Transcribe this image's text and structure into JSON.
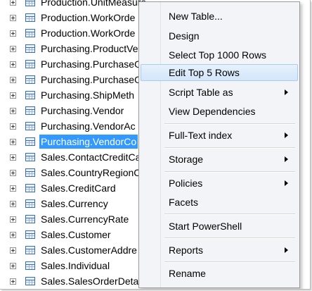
{
  "tree": {
    "items": [
      {
        "label": "Production.UnitMeasure"
      },
      {
        "label": "Production.WorkOrde"
      },
      {
        "label": "Production.WorkOrde"
      },
      {
        "label": "Purchasing.ProductVe"
      },
      {
        "label": "Purchasing.PurchaseO"
      },
      {
        "label": "Purchasing.PurchaseO"
      },
      {
        "label": "Purchasing.ShipMeth"
      },
      {
        "label": "Purchasing.Vendor"
      },
      {
        "label": "Purchasing.VendorAc"
      },
      {
        "label": "Purchasing.VendorCo",
        "selected": true
      },
      {
        "label": "Sales.ContactCreditCa"
      },
      {
        "label": "Sales.CountryRegionC"
      },
      {
        "label": "Sales.CreditCard"
      },
      {
        "label": "Sales.Currency"
      },
      {
        "label": "Sales.CurrencyRate"
      },
      {
        "label": "Sales.Customer"
      },
      {
        "label": "Sales.CustomerAddre"
      },
      {
        "label": "Sales.Individual"
      },
      {
        "label": "Sales.SalesOrderDetai"
      }
    ]
  },
  "context_menu": {
    "items": [
      {
        "label": "New Table..."
      },
      {
        "label": "Design"
      },
      {
        "label": "Select Top 1000 Rows"
      },
      {
        "label": "Edit Top 5 Rows",
        "highlighted": true
      },
      {
        "label": "Script Table as",
        "submenu": true
      },
      {
        "label": "View Dependencies"
      },
      {
        "label": "Full-Text index",
        "submenu": true
      },
      {
        "label": "Storage",
        "submenu": true
      },
      {
        "label": "Policies",
        "submenu": true
      },
      {
        "label": "Facets"
      },
      {
        "label": "Start PowerShell"
      },
      {
        "label": "Reports",
        "submenu": true
      },
      {
        "label": "Rename"
      }
    ]
  },
  "colors": {
    "selection": "#3399ff",
    "menu_background": "#f2f4f7",
    "menu_highlight": "#d3e6fa",
    "menu_highlight_border": "#a8cbef"
  }
}
